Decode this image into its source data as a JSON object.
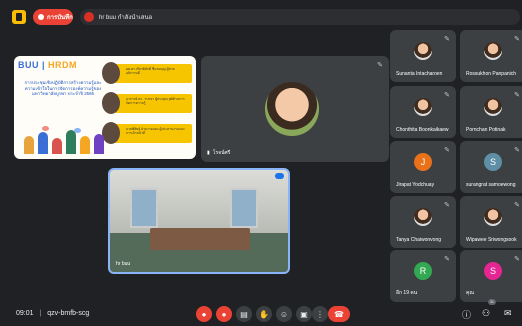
{
  "topbar": {
    "rec_label": "การบันทึก",
    "presenter_label": "hr buu กำลังนำเสนอ"
  },
  "slide": {
    "logo_main": "BUU",
    "logo_sep": " | ",
    "logo_acc": "HRDM",
    "title": "การประชุมเชิงปฏิบัติการสร้างความรู้และความเข้าใจในการจัดการองค์ความรู้ของมหาวิทยาลัยบูรพา ประจำปี 2566",
    "speakers": [
      "ผศ.ดร.เกียรติศักดิ์ ชื่นชมบุญ ผู้ช่วยอธิการบดี",
      "อาจารย์ ดร. วรรณา ผู้ทรงคุณวุฒิด้านการจัดการความรู้",
      "นายพิศิษฐ์ ฝ่ายวางแผน ผู้ประสานงานกองการเจ้าหน้าที่"
    ]
  },
  "face_tile": {
    "name": "โรจน์ศรี"
  },
  "room_tile": {
    "name": "hr buu"
  },
  "participants": [
    {
      "name": "Sunanta Intacharoen",
      "type": "photo"
    },
    {
      "name": "Rossukhon Panpanich",
      "type": "photo"
    },
    {
      "name": "Chonthita Boonkaikaew",
      "type": "photo"
    },
    {
      "name": "Pornchan Potinak",
      "type": "photo"
    },
    {
      "name": "Jirapat Yodchuay",
      "type": "initial",
      "initial": "J",
      "color": "#e8711a"
    },
    {
      "name": "surangrat samoewong",
      "type": "initial",
      "initial": "S",
      "color": "#5f8fa6"
    },
    {
      "name": "Tanya Chaiwonvong",
      "type": "photo"
    },
    {
      "name": "Wipawee Sriwongsook",
      "type": "photo"
    },
    {
      "name": "อีก 19 คน",
      "type": "group",
      "initial": "R",
      "color": "#33a852"
    },
    {
      "name": "คุณ",
      "type": "initial",
      "initial": "S",
      "color": "#e52592"
    }
  ],
  "bottombar": {
    "clock": "09:01",
    "separator": "|",
    "meeting_code": "qzv-bmfb-scg",
    "participant_count": "31"
  }
}
